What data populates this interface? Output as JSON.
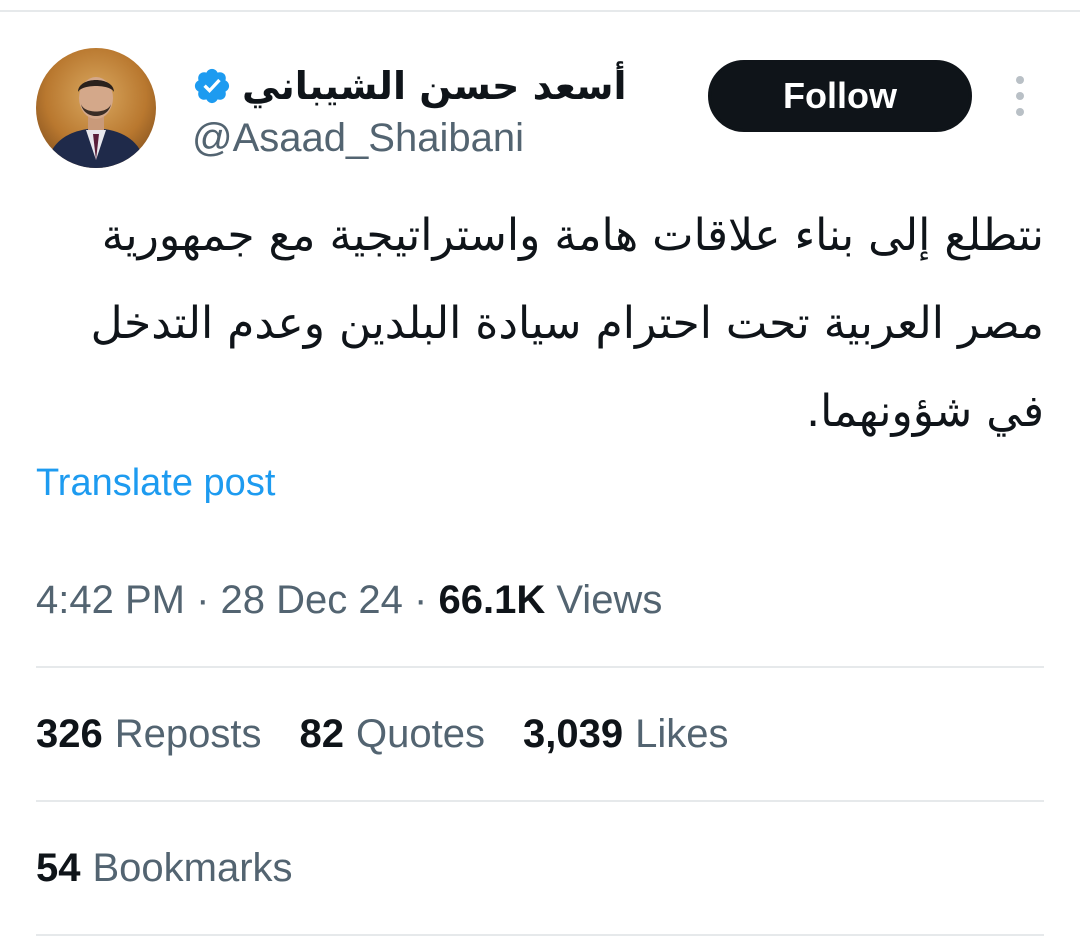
{
  "author": {
    "display_name": "أسعد حسن الشيباني",
    "handle": "@Asaad_Shaibani",
    "verified_icon": "verified-badge-icon",
    "accent_color": "#1d9bf0"
  },
  "follow_button": {
    "label": "Follow"
  },
  "post": {
    "text": "نتطلع إلى بناء علاقات هامة واستراتيجية مع جمهورية مصر العربية تحت احترام سيادة البلدين وعدم التدخل في شؤونهما."
  },
  "translate": {
    "label": "Translate post"
  },
  "meta": {
    "time": "4:42 PM",
    "separator": "·",
    "date": "28 Dec 24",
    "views_count": "66.1K",
    "views_label": "Views"
  },
  "stats": {
    "reposts_count": "326",
    "reposts_label": "Reposts",
    "quotes_count": "82",
    "quotes_label": "Quotes",
    "likes_count": "3,039",
    "likes_label": "Likes",
    "bookmarks_count": "54",
    "bookmarks_label": "Bookmarks"
  }
}
